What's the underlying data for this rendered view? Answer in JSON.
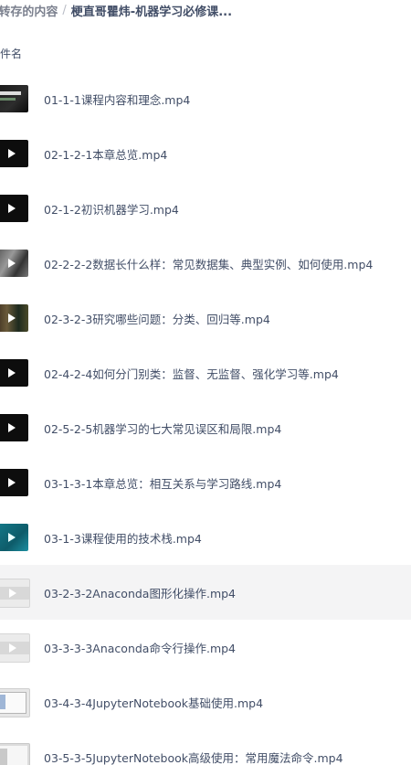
{
  "breadcrumb": {
    "separator": "/",
    "parent": "转存的内容",
    "current": "梗直哥瞿炜-机器学习必修课..."
  },
  "list_header": {
    "name_column": "文件名"
  },
  "files": [
    {
      "name": "01-1-1课程内容和理念.mp4",
      "thumb": "dark-slide"
    },
    {
      "name": "02-1-2-1本章总览.mp4",
      "thumb": "black"
    },
    {
      "name": "02-1-2初识机器学习.mp4",
      "thumb": "black"
    },
    {
      "name": "02-2-2-2数据长什么样：常见数据集、典型实例、如何使用.mp4",
      "thumb": "rocky"
    },
    {
      "name": "02-3-2-3研究哪些问题：分类、回归等.mp4",
      "thumb": "wood"
    },
    {
      "name": "02-4-2-4如何分门别类：监督、无监督、强化学习等.mp4",
      "thumb": "black"
    },
    {
      "name": "02-5-2-5机器学习的七大常见误区和局限.mp4",
      "thumb": "black"
    },
    {
      "name": "03-1-3-1本章总览：相互关系与学习路线.mp4",
      "thumb": "black"
    },
    {
      "name": "03-1-3课程使用的技术栈.mp4",
      "thumb": "teal"
    },
    {
      "name": "03-2-3-2Anaconda图形化操作.mp4",
      "thumb": "light",
      "hover": true
    },
    {
      "name": "03-3-3-3Anaconda命令行操作.mp4",
      "thumb": "light"
    },
    {
      "name": "03-4-3-4JupyterNotebook基础使用.mp4",
      "thumb": "app"
    },
    {
      "name": "03-5-3-5JupyterNotebook高级使用：常用魔法命令.mp4",
      "thumb": "jupy"
    }
  ]
}
